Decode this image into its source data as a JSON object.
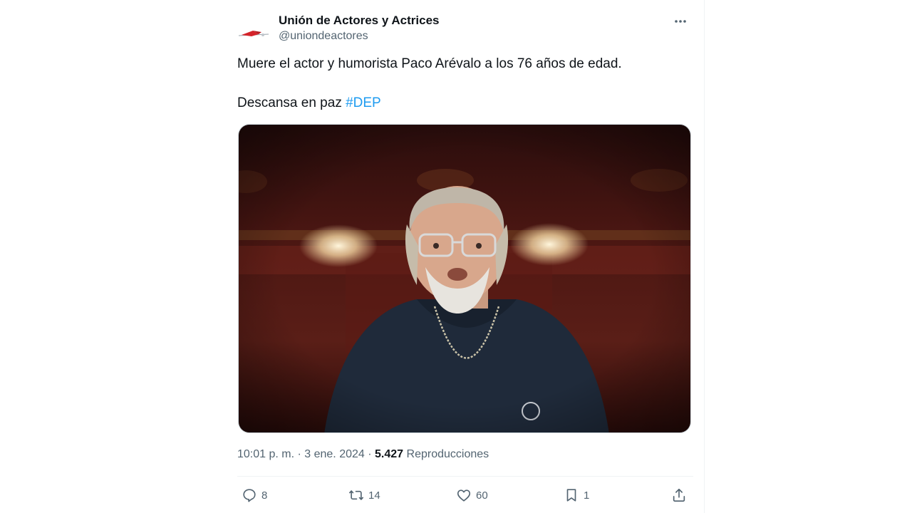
{
  "account": {
    "display_name": "Unión de Actores y Actrices",
    "handle": "@uniondeactores"
  },
  "tweet": {
    "line1": "Muere el actor y humorista Paco Arévalo a los 76 años de edad.",
    "line2_prefix": "Descansa en paz ",
    "hashtag": "#DEP"
  },
  "meta": {
    "time": "10:01 p. m.",
    "dot1": " · ",
    "date": "3 ene. 2024",
    "dot2": " · ",
    "views_count": "5.427",
    "views_label": " Reproducciones"
  },
  "actions": {
    "replies": "8",
    "reposts": "14",
    "likes": "60",
    "bookmarks": "1"
  },
  "icons": {
    "more": "more-horizontal-icon",
    "reply": "reply-icon",
    "repost": "repost-icon",
    "like": "heart-icon",
    "bookmark": "bookmark-icon",
    "share": "share-icon"
  },
  "colors": {
    "accent": "#1d9bf0",
    "secondary_text": "#536471",
    "primary_text": "#0f1419"
  }
}
